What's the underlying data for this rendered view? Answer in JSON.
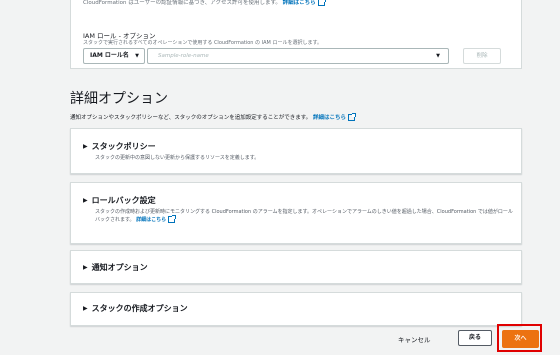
{
  "top_note": {
    "text": "CloudFormation はユーザーの認証情報に基づき、アクセス許可を使用します。",
    "link": "詳細はこちら"
  },
  "iam": {
    "title": "IAM ロール - オプション",
    "description": "スタックで実行されるすべてのオペレーションで使用する CloudFormation の IAM ロールを選択します。",
    "select_value": "IAM ロール名",
    "role_placeholder": "Sample-role-name",
    "delete_label": "削除"
  },
  "advanced": {
    "title": "詳細オプション",
    "description": "通知オプションやスタックポリシーなど、スタックのオプションを追加設定することができます。",
    "link": "詳細はこちら"
  },
  "sections": [
    {
      "title": "スタックポリシー",
      "description": "スタックの更新中の意図しない更新から保護するリソースを定義します。"
    },
    {
      "title": "ロールバック設定",
      "description": "スタックの作成時および更新時にモニタリングする CloudFormation のアラームを指定します。オペレーションでアラームのしきい値を超過した場合、CloudFormation では値がロールバックされます。",
      "link": "詳細はこちら"
    },
    {
      "title": "通知オプション"
    },
    {
      "title": "スタックの作成オプション"
    }
  ],
  "footer": {
    "cancel": "キャンセル",
    "back": "戻る",
    "next": "次へ"
  },
  "colors": {
    "primary_button": "#ec7211",
    "highlight": "#e00000",
    "link": "#0073bb"
  }
}
